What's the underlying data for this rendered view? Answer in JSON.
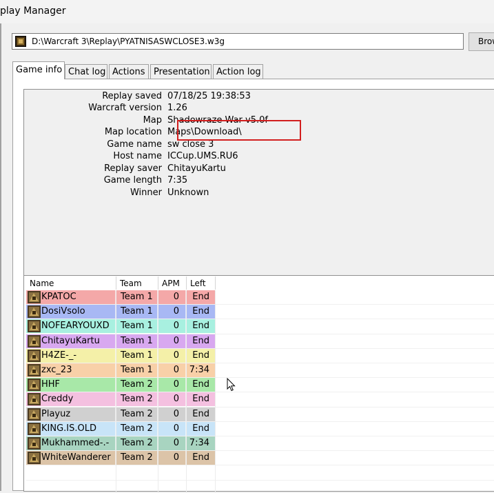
{
  "window": {
    "title": "play Manager"
  },
  "toolbar": {
    "path": "D:\\Warcraft 3\\Replay\\PYATNISASWCLOSE3.w3g",
    "browse_label": "Brow"
  },
  "tabs": [
    {
      "label": "Game info",
      "active": true
    },
    {
      "label": "Chat log"
    },
    {
      "label": "Actions"
    },
    {
      "label": "Presentation"
    },
    {
      "label": "Action log"
    }
  ],
  "info": [
    {
      "label": "Replay saved",
      "value": "07/18/25 19:38:53"
    },
    {
      "label": "Warcraft version",
      "value": "1.26"
    },
    {
      "label": "Map",
      "value": "Shadowraze War v5.0f"
    },
    {
      "label": "Map location",
      "value": "Maps\\Download\\"
    },
    {
      "label": "Game name",
      "value": "sw close 3"
    },
    {
      "label": "Host name",
      "value": "ICCup.UMS.RU6"
    },
    {
      "label": "Replay saver",
      "value": "ChitayuKartu"
    },
    {
      "label": "Game length",
      "value": "7:35"
    },
    {
      "label": "Winner",
      "value": "Unknown"
    }
  ],
  "players_table": {
    "columns": [
      "Name",
      "Team",
      "APM",
      "Left"
    ],
    "rows": [
      {
        "name": "KPATOC",
        "team": "Team 1",
        "apm": "0",
        "left": "End",
        "color": "#f4a8a8"
      },
      {
        "name": "DosiVsolo",
        "team": "Team 1",
        "apm": "0",
        "left": "End",
        "color": "#a8b8f4"
      },
      {
        "name": "NOFEARYOUXD",
        "team": "Team 1",
        "apm": "0",
        "left": "End",
        "color": "#a8f0e0"
      },
      {
        "name": "ChitayuKartu",
        "team": "Team 1",
        "apm": "0",
        "left": "End",
        "color": "#d8a8f0"
      },
      {
        "name": "H4ZE-_-",
        "team": "Team 1",
        "apm": "0",
        "left": "End",
        "color": "#f4f0a8"
      },
      {
        "name": "zxc_23",
        "team": "Team 1",
        "apm": "0",
        "left": "7:34",
        "color": "#f8d0a8"
      },
      {
        "name": "HHF",
        "team": "Team 2",
        "apm": "0",
        "left": "End",
        "color": "#a8e8a8"
      },
      {
        "name": "Creddy",
        "team": "Team 2",
        "apm": "0",
        "left": "End",
        "color": "#f4c0e0"
      },
      {
        "name": "Playuz",
        "team": "Team 2",
        "apm": "0",
        "left": "End",
        "color": "#d0d0d0"
      },
      {
        "name": "KING.IS.OLD",
        "team": "Team 2",
        "apm": "0",
        "left": "End",
        "color": "#c8e4f8"
      },
      {
        "name": "Mukhammed-.-",
        "team": "Team 2",
        "apm": "0",
        "left": "7:34",
        "color": "#a8d4c0"
      },
      {
        "name": "WhiteWanderer",
        "team": "Team 2",
        "apm": "0",
        "left": "End",
        "color": "#dcc4a8"
      }
    ]
  },
  "highlight_color": "#d21e1e"
}
